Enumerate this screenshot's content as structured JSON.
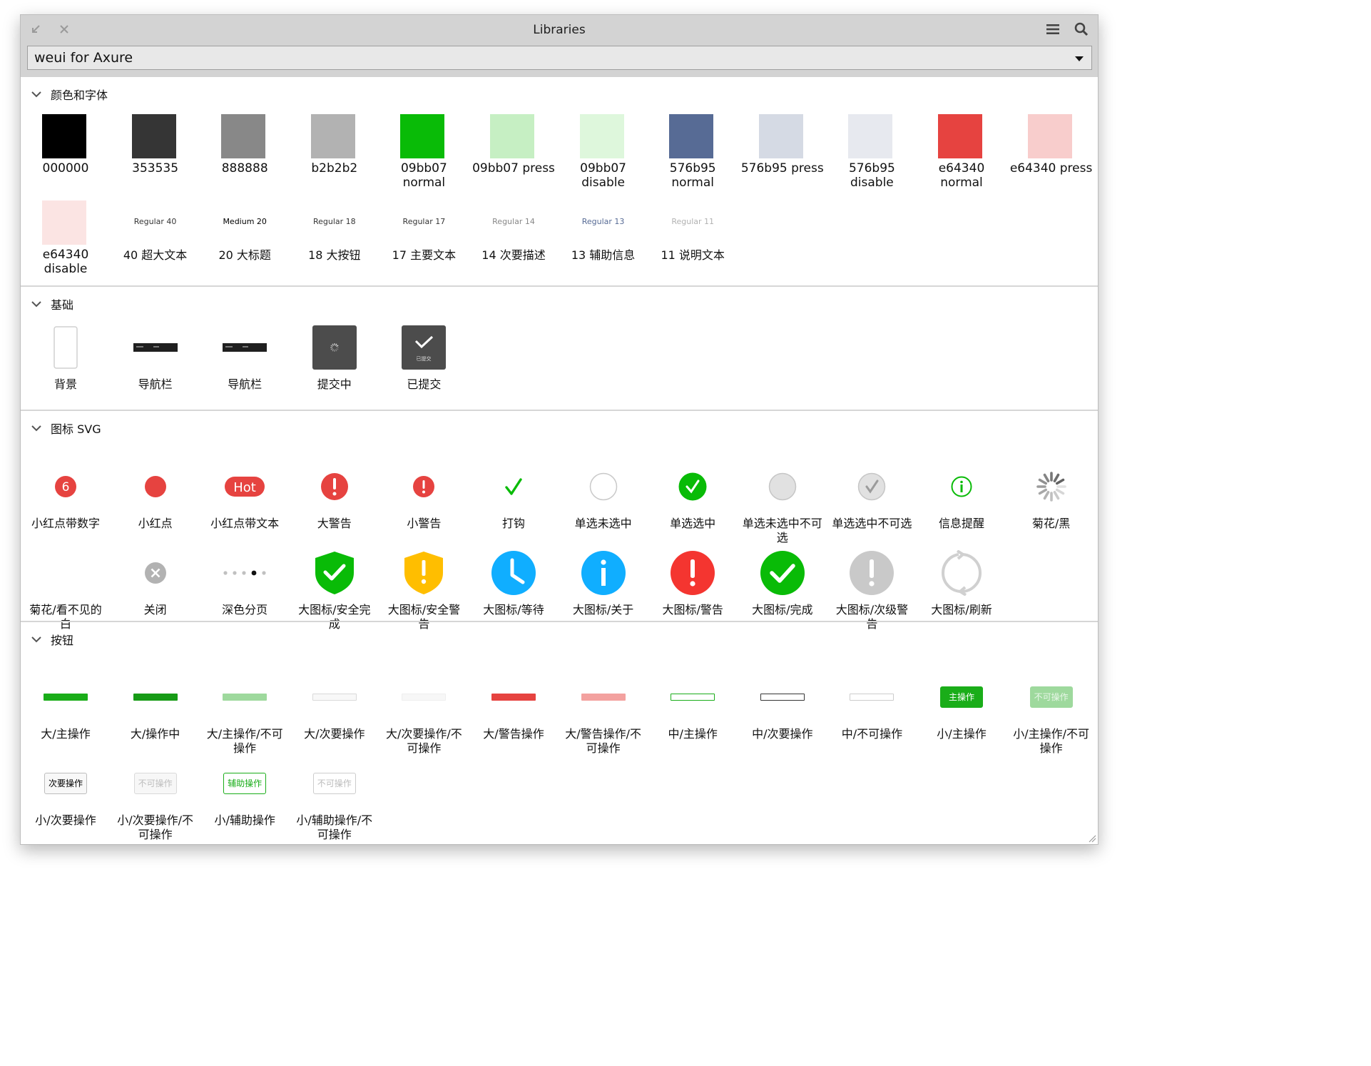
{
  "window": {
    "title": "Libraries"
  },
  "library_select": {
    "value": "weui for Axure"
  },
  "sections": {
    "colors": {
      "title": "颜色和字体"
    },
    "basic": {
      "title": "基础"
    },
    "icons": {
      "title": "图标 SVG"
    },
    "buttons": {
      "title": "按钮"
    }
  },
  "colors": {
    "swatches": [
      {
        "label": "000000",
        "color": "#000000"
      },
      {
        "label": "353535",
        "color": "#353535"
      },
      {
        "label": "888888",
        "color": "#888888"
      },
      {
        "label": "b2b2b2",
        "color": "#b2b2b2"
      },
      {
        "label": "09bb07\nnormal",
        "color": "#09bb07"
      },
      {
        "label": "09bb07 press",
        "color": "#c6efc3"
      },
      {
        "label": "09bb07\ndisable",
        "color": "#def7dc"
      },
      {
        "label": "576b95\nnormal",
        "color": "#576b95"
      },
      {
        "label": "576b95 press",
        "color": "#d5dae4"
      },
      {
        "label": "576b95\ndisable",
        "color": "#e7e9ef"
      },
      {
        "label": "e64340\nnormal",
        "color": "#e64340"
      },
      {
        "label": "e64340 press",
        "color": "#f8cdcc"
      },
      {
        "label": "e64340\ndisable",
        "color": "#fbe4e3"
      }
    ],
    "typography": [
      {
        "caption": "Regular 40",
        "label": "40 超大文本",
        "color": "#353535"
      },
      {
        "caption": "Medium 20",
        "label": "20 大标题",
        "color": "#000000"
      },
      {
        "caption": "Regular 18",
        "label": "18 大按钮",
        "color": "#353535"
      },
      {
        "caption": "Regular 17",
        "label": "17 主要文本",
        "color": "#353535"
      },
      {
        "caption": "Regular 14",
        "label": "14 次要描述",
        "color": "#888888"
      },
      {
        "caption": "Regular 13",
        "label": "13 辅助信息",
        "color": "#576b95"
      },
      {
        "caption": "Regular 11",
        "label": "11 说明文本",
        "color": "#b2b2b2"
      }
    ]
  },
  "basic": {
    "items": [
      {
        "label": "背景",
        "icon": "background-thumb"
      },
      {
        "label": "导航栏",
        "icon": "navbar-thumb"
      },
      {
        "label": "导航栏",
        "icon": "navbar-thumb"
      },
      {
        "label": "提交中",
        "icon": "submitting-toast"
      },
      {
        "label": "已提交",
        "icon": "submitted-toast",
        "toast_text": "已提交"
      }
    ]
  },
  "icons": {
    "row1": [
      {
        "label": "小红点带数字",
        "icon": "red-dot-number",
        "badge": "6"
      },
      {
        "label": "小红点",
        "icon": "red-dot"
      },
      {
        "label": "小红点带文本",
        "icon": "red-dot-text",
        "badge": "Hot"
      },
      {
        "label": "大警告",
        "icon": "warn-large"
      },
      {
        "label": "小警告",
        "icon": "warn-small"
      },
      {
        "label": "打钩",
        "icon": "check"
      },
      {
        "label": "单选未选中",
        "icon": "radio-unchecked"
      },
      {
        "label": "单选选中",
        "icon": "radio-checked"
      },
      {
        "label": "单选未选中不可\n选",
        "icon": "radio-unchecked-disabled"
      },
      {
        "label": "单选选中不可选",
        "icon": "radio-checked-disabled"
      },
      {
        "label": "信息提醒",
        "icon": "info-outline"
      },
      {
        "label": "菊花/黑",
        "icon": "spinner-dark"
      }
    ],
    "row2": [
      {
        "label": "菊花/看不见的\n白",
        "icon": "spinner-white"
      },
      {
        "label": "关闭",
        "icon": "close-circle"
      },
      {
        "label": "深色分页",
        "icon": "dark-pagination"
      },
      {
        "label": "大图标/安全完\n成",
        "icon": "shield-success"
      },
      {
        "label": "大图标/安全警\n告",
        "icon": "shield-warning"
      },
      {
        "label": "大图标/等待",
        "icon": "clock-waiting"
      },
      {
        "label": "大图标/关于",
        "icon": "info-large"
      },
      {
        "label": "大图标/警告",
        "icon": "warn-big"
      },
      {
        "label": "大图标/完成",
        "icon": "success-big"
      },
      {
        "label": "大图标/次级警\n告",
        "icon": "warn-secondary"
      },
      {
        "label": "大图标/刷新",
        "icon": "refresh"
      }
    ]
  },
  "buttons": {
    "row1": [
      {
        "label": "大/主操作",
        "kind": "mini",
        "bg": "#1aad19",
        "border": "#1aad19"
      },
      {
        "label": "大/操作中",
        "kind": "mini",
        "bg": "#179b16",
        "border": "#179b16"
      },
      {
        "label": "大/主操作/不可\n操作",
        "kind": "mini",
        "bg": "#9ed99d",
        "border": "#9ed99d"
      },
      {
        "label": "大/次要操作",
        "kind": "mini",
        "bg": "#f8f8f8",
        "border": "#d9d9d9"
      },
      {
        "label": "大/次要操作/不\n可操作",
        "kind": "mini",
        "bg": "#f7f7f7",
        "border": "#eeeeee"
      },
      {
        "label": "大/警告操作",
        "kind": "mini",
        "bg": "#e64340",
        "border": "#e64340"
      },
      {
        "label": "大/警告操作/不\n可操作",
        "kind": "mini",
        "bg": "#f3a19f",
        "border": "#f3a19f"
      },
      {
        "label": "中/主操作",
        "kind": "mini",
        "bg": "#ffffff",
        "border": "#1aad19"
      },
      {
        "label": "中/次要操作",
        "kind": "mini",
        "bg": "#ffffff",
        "border": "#353535"
      },
      {
        "label": "中/不可操作",
        "kind": "mini",
        "bg": "#ffffff",
        "border": "#cccccc"
      },
      {
        "label": "小/主操作",
        "kind": "small",
        "text": "主操作",
        "bg": "#1aad19",
        "border": "#1aad19",
        "fg": "#ffffff"
      },
      {
        "label": "小/主操作/不可\n操作",
        "kind": "small",
        "text": "不可操作",
        "bg": "#9ed99d",
        "border": "#9ed99d",
        "fg": "#e9f7e9"
      }
    ],
    "row2": [
      {
        "label": "小/次要操作",
        "kind": "small",
        "text": "次要操作",
        "bg": "#f8f8f8",
        "border": "#bdbdbd",
        "fg": "#000000"
      },
      {
        "label": "小/次要操作/不\n可操作",
        "kind": "small",
        "text": "不可操作",
        "bg": "#f7f7f7",
        "border": "#d9d9d9",
        "fg": "#bdbdbd"
      },
      {
        "label": "小/辅助操作",
        "kind": "small",
        "text": "辅助操作",
        "bg": "#ffffff",
        "border": "#1aad19",
        "fg": "#1aad19"
      },
      {
        "label": "小/辅助操作/不\n可操作",
        "kind": "small",
        "text": "不可操作",
        "bg": "#ffffff",
        "border": "#cccccc",
        "fg": "#bbbbbb"
      }
    ]
  }
}
